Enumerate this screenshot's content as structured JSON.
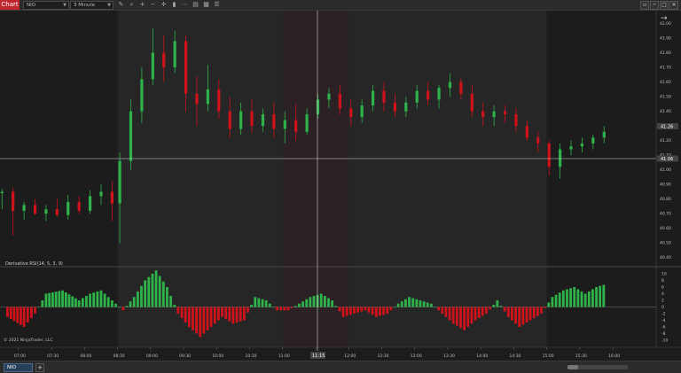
{
  "app": {
    "tab_label": "Chart"
  },
  "toolbar": {
    "instrument": "NIO",
    "interval": "3 Minute",
    "icons": [
      "pencil-icon",
      "magnifier-icon",
      "zoom-in-icon",
      "zoom-out-icon",
      "crosshair-icon",
      "bar-type-icon",
      "indicators-icon",
      "strategies-icon",
      "templates-icon",
      "properties-icon"
    ]
  },
  "window_buttons": [
    "▫",
    "─",
    "□",
    "✕"
  ],
  "price_axis": {
    "labels": [
      "42.00",
      "41.90",
      "41.80",
      "41.70",
      "41.60",
      "41.50",
      "41.40",
      "41.30",
      "41.20",
      "41.10",
      "41.00",
      "40.90",
      "40.80",
      "40.70",
      "40.60",
      "40.50",
      "40.40"
    ],
    "current_price": "41.26",
    "crosshair_price": "41.06"
  },
  "indicator": {
    "label": "Derivative RSI(14, 5, 3, 9)",
    "axis_labels": [
      "10",
      "8",
      "6",
      "4",
      "2",
      "0",
      "-2",
      "-4",
      "-6",
      "-8",
      "-10"
    ]
  },
  "time_axis": {
    "labels": [
      "07:00",
      "07:30",
      "08:00",
      "08:30",
      "09:00",
      "09:30",
      "10:00",
      "10:30",
      "11:00",
      "11:30",
      "12:00",
      "12:30",
      "13:00",
      "13:30",
      "14:00",
      "14:30",
      "15:00",
      "15:30",
      "16:00"
    ],
    "crosshair_time": "11:15"
  },
  "copyright": "© 2021 NinjaTrader, LLC",
  "bottom": {
    "instrument_tab": "NIO",
    "add_label": "+"
  },
  "colors": {
    "up": "#2db34a",
    "down": "#d0121b",
    "bg": "#1c1c1c",
    "session_bg": "#262626",
    "highlight": "#2b2024"
  },
  "chart_data": {
    "type": "candlestick",
    "bar_interval": "3 Minute",
    "price_range": [
      40.38,
      42.04
    ],
    "indicator_range": [
      -10,
      10
    ],
    "session_start": "08:30",
    "session_end": "15:00",
    "highlight_range": [
      "11:00",
      "12:00"
    ],
    "candles": [
      {
        "t": "06:45",
        "o": 40.84,
        "h": 40.87,
        "l": 40.73,
        "c": 40.85
      },
      {
        "t": "06:55",
        "o": 40.85,
        "h": 40.88,
        "l": 40.55,
        "c": 40.72
      },
      {
        "t": "07:05",
        "o": 40.72,
        "h": 40.78,
        "l": 40.66,
        "c": 40.76
      },
      {
        "t": "07:15",
        "o": 40.76,
        "h": 40.8,
        "l": 40.69,
        "c": 40.7
      },
      {
        "t": "07:25",
        "o": 40.7,
        "h": 40.76,
        "l": 40.65,
        "c": 40.73
      },
      {
        "t": "07:35",
        "o": 40.73,
        "h": 40.8,
        "l": 40.68,
        "c": 40.69
      },
      {
        "t": "07:45",
        "o": 40.69,
        "h": 40.83,
        "l": 40.66,
        "c": 40.78
      },
      {
        "t": "07:55",
        "o": 40.78,
        "h": 40.82,
        "l": 40.7,
        "c": 40.72
      },
      {
        "t": "08:05",
        "o": 40.72,
        "h": 40.86,
        "l": 40.7,
        "c": 40.82
      },
      {
        "t": "08:15",
        "o": 40.82,
        "h": 40.9,
        "l": 40.76,
        "c": 40.85
      },
      {
        "t": "08:25",
        "o": 40.85,
        "h": 40.92,
        "l": 40.65,
        "c": 40.77
      },
      {
        "t": "08:32",
        "o": 40.77,
        "h": 41.12,
        "l": 40.5,
        "c": 41.06
      },
      {
        "t": "08:42",
        "o": 41.06,
        "h": 41.48,
        "l": 41.0,
        "c": 41.4
      },
      {
        "t": "08:52",
        "o": 41.4,
        "h": 41.7,
        "l": 41.32,
        "c": 41.62
      },
      {
        "t": "09:02",
        "o": 41.62,
        "h": 41.97,
        "l": 41.58,
        "c": 41.8
      },
      {
        "t": "09:12",
        "o": 41.8,
        "h": 41.92,
        "l": 41.6,
        "c": 41.7
      },
      {
        "t": "09:22",
        "o": 41.7,
        "h": 41.95,
        "l": 41.66,
        "c": 41.88
      },
      {
        "t": "09:32",
        "o": 41.88,
        "h": 41.92,
        "l": 41.4,
        "c": 41.52
      },
      {
        "t": "09:42",
        "o": 41.52,
        "h": 41.64,
        "l": 41.3,
        "c": 41.45
      },
      {
        "t": "09:52",
        "o": 41.45,
        "h": 41.72,
        "l": 41.4,
        "c": 41.55
      },
      {
        "t": "10:02",
        "o": 41.55,
        "h": 41.62,
        "l": 41.35,
        "c": 41.4
      },
      {
        "t": "10:12",
        "o": 41.4,
        "h": 41.5,
        "l": 41.22,
        "c": 41.28
      },
      {
        "t": "10:22",
        "o": 41.28,
        "h": 41.46,
        "l": 41.24,
        "c": 41.4
      },
      {
        "t": "10:32",
        "o": 41.4,
        "h": 41.48,
        "l": 41.25,
        "c": 41.3
      },
      {
        "t": "10:42",
        "o": 41.3,
        "h": 41.42,
        "l": 41.26,
        "c": 41.38
      },
      {
        "t": "10:52",
        "o": 41.38,
        "h": 41.46,
        "l": 41.22,
        "c": 41.28
      },
      {
        "t": "11:02",
        "o": 41.28,
        "h": 41.4,
        "l": 41.18,
        "c": 41.34
      },
      {
        "t": "11:12",
        "o": 41.34,
        "h": 41.45,
        "l": 41.2,
        "c": 41.26
      },
      {
        "t": "11:22",
        "o": 41.26,
        "h": 41.42,
        "l": 41.24,
        "c": 41.38
      },
      {
        "t": "11:32",
        "o": 41.38,
        "h": 41.52,
        "l": 41.35,
        "c": 41.48
      },
      {
        "t": "11:42",
        "o": 41.48,
        "h": 41.56,
        "l": 41.42,
        "c": 41.52
      },
      {
        "t": "11:52",
        "o": 41.52,
        "h": 41.58,
        "l": 41.38,
        "c": 41.42
      },
      {
        "t": "12:02",
        "o": 41.42,
        "h": 41.48,
        "l": 41.3,
        "c": 41.36
      },
      {
        "t": "12:12",
        "o": 41.36,
        "h": 41.48,
        "l": 41.32,
        "c": 41.44
      },
      {
        "t": "12:22",
        "o": 41.44,
        "h": 41.58,
        "l": 41.4,
        "c": 41.54
      },
      {
        "t": "12:32",
        "o": 41.54,
        "h": 41.6,
        "l": 41.4,
        "c": 41.46
      },
      {
        "t": "12:42",
        "o": 41.46,
        "h": 41.52,
        "l": 41.36,
        "c": 41.4
      },
      {
        "t": "12:52",
        "o": 41.4,
        "h": 41.5,
        "l": 41.36,
        "c": 41.46
      },
      {
        "t": "13:02",
        "o": 41.46,
        "h": 41.58,
        "l": 41.42,
        "c": 41.54
      },
      {
        "t": "13:12",
        "o": 41.54,
        "h": 41.6,
        "l": 41.44,
        "c": 41.48
      },
      {
        "t": "13:22",
        "o": 41.48,
        "h": 41.58,
        "l": 41.42,
        "c": 41.56
      },
      {
        "t": "13:32",
        "o": 41.56,
        "h": 41.66,
        "l": 41.5,
        "c": 41.6
      },
      {
        "t": "13:42",
        "o": 41.6,
        "h": 41.63,
        "l": 41.48,
        "c": 41.52
      },
      {
        "t": "13:52",
        "o": 41.52,
        "h": 41.58,
        "l": 41.36,
        "c": 41.4
      },
      {
        "t": "14:02",
        "o": 41.4,
        "h": 41.46,
        "l": 41.3,
        "c": 41.36
      },
      {
        "t": "14:12",
        "o": 41.36,
        "h": 41.44,
        "l": 41.3,
        "c": 41.4
      },
      {
        "t": "14:22",
        "o": 41.4,
        "h": 41.44,
        "l": 41.32,
        "c": 41.38
      },
      {
        "t": "14:32",
        "o": 41.38,
        "h": 41.42,
        "l": 41.26,
        "c": 41.3
      },
      {
        "t": "14:42",
        "o": 41.3,
        "h": 41.34,
        "l": 41.2,
        "c": 41.22
      },
      {
        "t": "14:52",
        "o": 41.22,
        "h": 41.26,
        "l": 41.12,
        "c": 41.18
      },
      {
        "t": "15:02",
        "o": 41.18,
        "h": 41.2,
        "l": 40.96,
        "c": 41.02
      },
      {
        "t": "15:12",
        "o": 41.02,
        "h": 41.18,
        "l": 40.94,
        "c": 41.14
      },
      {
        "t": "15:22",
        "o": 41.14,
        "h": 41.2,
        "l": 41.1,
        "c": 41.16
      },
      {
        "t": "15:32",
        "o": 41.16,
        "h": 41.22,
        "l": 41.12,
        "c": 41.18
      },
      {
        "t": "15:42",
        "o": 41.18,
        "h": 41.24,
        "l": 41.14,
        "c": 41.22
      },
      {
        "t": "15:52",
        "o": 41.22,
        "h": 41.3,
        "l": 41.18,
        "c": 41.26
      }
    ],
    "indicator_series": {
      "name": "Derivative RSI(14, 5, 3, 9)",
      "points": [
        {
          "t": "06:50",
          "v": -3
        },
        {
          "t": "07:05",
          "v": -6
        },
        {
          "t": "07:15",
          "v": -2
        },
        {
          "t": "07:25",
          "v": 4
        },
        {
          "t": "07:40",
          "v": 5
        },
        {
          "t": "07:55",
          "v": 2
        },
        {
          "t": "08:05",
          "v": 4
        },
        {
          "t": "08:15",
          "v": 5
        },
        {
          "t": "08:25",
          "v": 2
        },
        {
          "t": "08:35",
          "v": -1
        },
        {
          "t": "08:45",
          "v": 3
        },
        {
          "t": "08:55",
          "v": 8
        },
        {
          "t": "09:05",
          "v": 11
        },
        {
          "t": "09:15",
          "v": 6
        },
        {
          "t": "09:25",
          "v": -2
        },
        {
          "t": "09:35",
          "v": -6
        },
        {
          "t": "09:45",
          "v": -9
        },
        {
          "t": "09:55",
          "v": -6
        },
        {
          "t": "10:05",
          "v": -3
        },
        {
          "t": "10:15",
          "v": -5
        },
        {
          "t": "10:25",
          "v": -4
        },
        {
          "t": "10:35",
          "v": 3
        },
        {
          "t": "10:45",
          "v": 2
        },
        {
          "t": "10:55",
          "v": -1
        },
        {
          "t": "11:05",
          "v": -1
        },
        {
          "t": "11:15",
          "v": 1
        },
        {
          "t": "11:25",
          "v": 3
        },
        {
          "t": "11:35",
          "v": 4
        },
        {
          "t": "11:45",
          "v": 2
        },
        {
          "t": "11:55",
          "v": -3
        },
        {
          "t": "12:05",
          "v": -2
        },
        {
          "t": "12:15",
          "v": -1
        },
        {
          "t": "12:25",
          "v": -3
        },
        {
          "t": "12:35",
          "v": -2
        },
        {
          "t": "12:45",
          "v": 1
        },
        {
          "t": "12:55",
          "v": 3
        },
        {
          "t": "13:05",
          "v": 2
        },
        {
          "t": "13:15",
          "v": 1
        },
        {
          "t": "13:25",
          "v": -2
        },
        {
          "t": "13:35",
          "v": -5
        },
        {
          "t": "13:45",
          "v": -7
        },
        {
          "t": "13:55",
          "v": -4
        },
        {
          "t": "14:05",
          "v": -2
        },
        {
          "t": "14:15",
          "v": 2
        },
        {
          "t": "14:25",
          "v": -3
        },
        {
          "t": "14:35",
          "v": -6
        },
        {
          "t": "14:45",
          "v": -4
        },
        {
          "t": "14:55",
          "v": -2
        },
        {
          "t": "15:05",
          "v": 3
        },
        {
          "t": "15:15",
          "v": 5
        },
        {
          "t": "15:25",
          "v": 6
        },
        {
          "t": "15:35",
          "v": 4
        },
        {
          "t": "15:45",
          "v": 6
        },
        {
          "t": "15:55",
          "v": 7
        }
      ]
    }
  }
}
